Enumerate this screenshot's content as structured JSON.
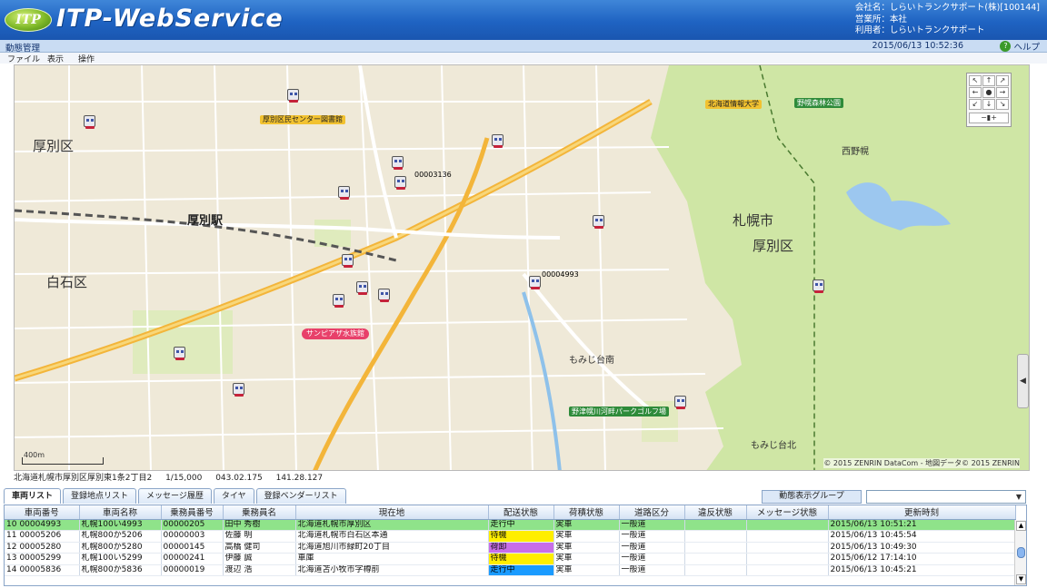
{
  "header": {
    "logo_text": "ITP",
    "title": "ITP-WebService",
    "company": "会社名：しらいトランクサポート(株)[100144]",
    "office": "営業所：本社",
    "user": "利用者：しらいトランクサポート"
  },
  "subheader": {
    "section_title": "動態管理",
    "datetime": "2015/06/13 10:52:36",
    "help_label": "ヘルプ"
  },
  "menu": [
    "ファイル",
    "表示",
    "操作"
  ],
  "map": {
    "labels": {
      "atsubetsu_ward": "厚別区",
      "atsubetsu_station": "厚別駅",
      "shiroishi_ward": "白石区",
      "sapporo_city": "札幌市",
      "atsubetsu_ward_east": "厚別区",
      "momijidai": "もみじ台南",
      "momijidai_north": "もみじ台北",
      "nishinomura": "西野幌",
      "park_golf": "野津幌川河畔パークゴルフ場",
      "sun_piazza": "サンピアザ水族館",
      "library": "厚別区民センター図書館",
      "school": "北海道情報大学",
      "nopporo_park": "野幌森林公園"
    },
    "vehicle_ids": [
      "00003136",
      "00004993"
    ],
    "scale_label": "400m",
    "copyright": "© 2015 ZENRIN DataCom - 地図データ© 2015 ZENRIN"
  },
  "status": {
    "address": "北海道札幌市厚別区厚別東1条2丁目2",
    "scale": "1/15,000",
    "lat": "043.02.175",
    "lon": "141.28.127"
  },
  "tabs": [
    "車両リスト",
    "登録地点リスト",
    "メッセージ履歴",
    "タイヤ",
    "登録ベンダーリスト"
  ],
  "group_filter": {
    "label": "動態表示グループ",
    "value": ""
  },
  "table": {
    "columns": [
      "車両番号",
      "車両名称",
      "乗務員番号",
      "乗務員名",
      "現在地",
      "配送状態",
      "荷積状態",
      "道路区分",
      "違反状態",
      "メッセージ状態",
      "更新時刻"
    ],
    "rows": [
      {
        "no": "10",
        "cells": [
          "00004993",
          "札幌100い4993",
          "00000205",
          "田中 秀樹",
          "北海道札幌市厚別区",
          "走行中",
          "実車",
          "一般道",
          "",
          "",
          "2015/06/13 10:51:21"
        ]
      },
      {
        "no": "11",
        "cells": [
          "00005206",
          "札幌800か5206",
          "00000003",
          "佐藤 明",
          "北海道札幌市白石区本通",
          "待機",
          "実車",
          "一般道",
          "",
          "",
          "2015/06/13 10:45:54"
        ]
      },
      {
        "no": "12",
        "cells": [
          "00005280",
          "札幌800か5280",
          "00000145",
          "高橋 健司",
          "北海道旭川市緑町20丁目",
          "荷卸",
          "実車",
          "一般道",
          "",
          "",
          "2015/06/13 10:49:30"
        ]
      },
      {
        "no": "13",
        "cells": [
          "00005299",
          "札幌100い5299",
          "00000241",
          "伊藤 誠",
          "車庫",
          "待機",
          "実車",
          "一般道",
          "",
          "",
          "2015/06/12 17:14:10"
        ]
      },
      {
        "no": "14",
        "cells": [
          "00005836",
          "札幌800か5836",
          "00000019",
          "渡辺 浩",
          "北海道苫小牧市字樽前",
          "走行中",
          "実車",
          "一般道",
          "",
          "",
          "2015/06/13 10:45:21"
        ]
      }
    ]
  },
  "colors": {
    "header_blue": "#1f63c2",
    "selected_row": "#8fe38a",
    "status_moving": "#1a9bff",
    "status_wait": "#ffee00",
    "status_unload": "#c86ee8"
  }
}
